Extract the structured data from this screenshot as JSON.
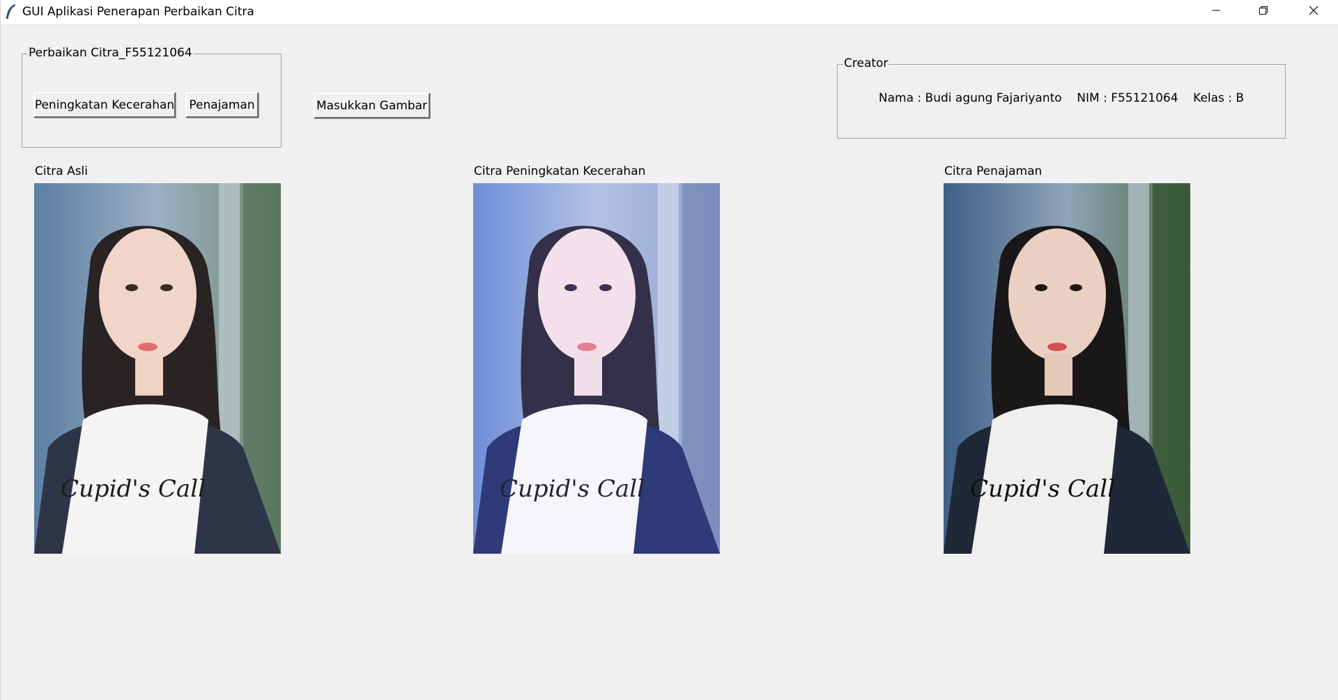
{
  "window": {
    "title": "GUI Aplikasi Penerapan Perbaikan Citra",
    "app_icon": "feather-icon",
    "controls": {
      "minimize_icon": "minimize-icon",
      "maximize_icon": "restore-icon",
      "close_icon": "close-icon"
    }
  },
  "group_perbaikan": {
    "legend": "Perbaikan Citra_F55121064",
    "buttons": {
      "brightness_label": "Peningkatan Kecerahan",
      "sharpen_label": "Penajaman"
    }
  },
  "load_button_label": "Masukkan Gambar",
  "group_creator": {
    "legend": "Creator",
    "info_line": "Nama : Budi agung Fajariyanto    NIM : F55121064    Kelas : B"
  },
  "panels": {
    "original": {
      "label": "Citra Asli"
    },
    "brightened": {
      "label": "Citra Peningkatan Kecerahan"
    },
    "sharpened": {
      "label": "Citra Penajaman"
    }
  },
  "colors": {
    "window_bg": "#f0f0f0",
    "titlebar_bg": "#ffffff",
    "groupbox_border": "#a0a0a0"
  }
}
